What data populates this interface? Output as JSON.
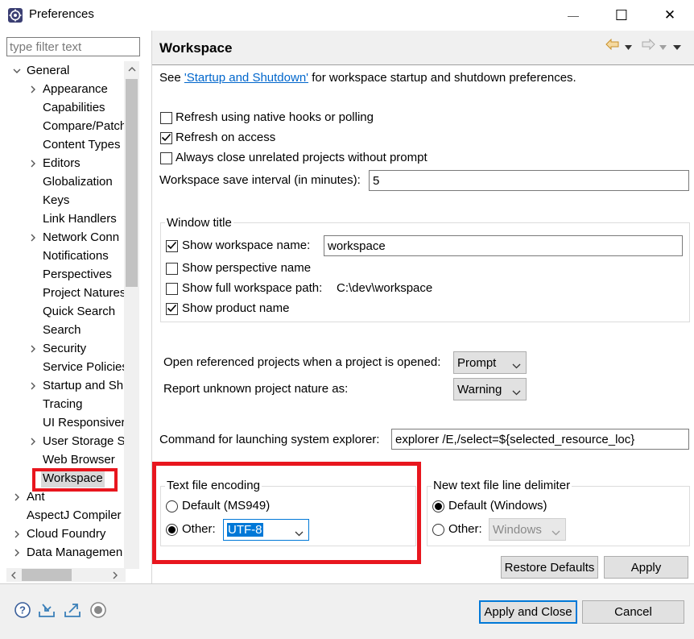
{
  "window": {
    "title": "Preferences",
    "minimize_glyph": "—",
    "maximize_glyph": "☐",
    "close_glyph": "✕"
  },
  "filter": {
    "placeholder": "type filter text"
  },
  "tree": {
    "items": [
      {
        "label": "General",
        "level": 0,
        "expanded": true
      },
      {
        "label": "Appearance",
        "level": 1,
        "has_children": true
      },
      {
        "label": "Capabilities",
        "level": 1
      },
      {
        "label": "Compare/Patch",
        "level": 1
      },
      {
        "label": "Content Types",
        "level": 1
      },
      {
        "label": "Editors",
        "level": 1,
        "has_children": true
      },
      {
        "label": "Globalization",
        "level": 1
      },
      {
        "label": "Keys",
        "level": 1
      },
      {
        "label": "Link Handlers",
        "level": 1
      },
      {
        "label": "Network Conn",
        "level": 1,
        "has_children": true
      },
      {
        "label": "Notifications",
        "level": 1
      },
      {
        "label": "Perspectives",
        "level": 1
      },
      {
        "label": "Project Natures",
        "level": 1
      },
      {
        "label": "Quick Search",
        "level": 1
      },
      {
        "label": "Search",
        "level": 1
      },
      {
        "label": "Security",
        "level": 1,
        "has_children": true
      },
      {
        "label": "Service Policies",
        "level": 1
      },
      {
        "label": "Startup and Sh",
        "level": 1,
        "has_children": true
      },
      {
        "label": "Tracing",
        "level": 1
      },
      {
        "label": "UI Responsiver",
        "level": 1
      },
      {
        "label": "User Storage S",
        "level": 1,
        "has_children": true
      },
      {
        "label": "Web Browser",
        "level": 1
      },
      {
        "label": "Workspace",
        "level": 1,
        "selected": true
      },
      {
        "label": "Ant",
        "level": 0,
        "has_children": true
      },
      {
        "label": "AspectJ Compiler",
        "level": 0
      },
      {
        "label": "Cloud Foundry",
        "level": 0,
        "has_children": true
      },
      {
        "label": "Data Managemen",
        "level": 0,
        "has_children": true
      }
    ]
  },
  "page": {
    "title": "Workspace",
    "intro_prefix": "See ",
    "intro_link": "'Startup and Shutdown'",
    "intro_suffix": " for workspace startup and shutdown preferences.",
    "refresh_native": {
      "label": "Refresh using native hooks or polling",
      "checked": false
    },
    "refresh_access": {
      "label": "Refresh on access",
      "checked": true
    },
    "always_close": {
      "label": "Always close unrelated projects without prompt",
      "checked": false
    },
    "save_interval": {
      "label": "Workspace save interval (in minutes):",
      "value": "5"
    },
    "window_title": {
      "label": "Window title",
      "show_workspace_name": {
        "label": "Show workspace name:",
        "checked": true,
        "value": "workspace"
      },
      "show_perspective_name": {
        "label": "Show perspective name",
        "checked": false
      },
      "show_full_path": {
        "label": "Show full workspace path:",
        "checked": false,
        "value": "C:\\dev\\workspace"
      },
      "show_product_name": {
        "label": "Show product name",
        "checked": true
      }
    },
    "open_referenced": {
      "label": "Open referenced projects when a project is opened:",
      "value": "Prompt"
    },
    "report_unknown": {
      "label": "Report unknown project nature as:",
      "value": "Warning"
    },
    "system_explorer": {
      "label": "Command for launching system explorer:",
      "value": "explorer /E,/select=${selected_resource_loc}"
    },
    "encoding": {
      "label": "Text file encoding",
      "default_label": "Default (MS949)",
      "other_label": "Other:",
      "other_value": "UTF-8",
      "selected": "other"
    },
    "line_delimiter": {
      "label": "New text file line delimiter",
      "default_label": "Default (Windows)",
      "other_label": "Other:",
      "other_value": "Windows",
      "selected": "default"
    },
    "restore_defaults": "Restore Defaults",
    "apply": "Apply"
  },
  "footer": {
    "apply_close": "Apply and Close",
    "cancel": "Cancel",
    "icons": [
      "help-icon",
      "import-icon",
      "export-icon",
      "record-icon"
    ]
  },
  "colors": {
    "accent": "#0078d7",
    "highlight": "#e8161e",
    "link": "#0066cc"
  }
}
